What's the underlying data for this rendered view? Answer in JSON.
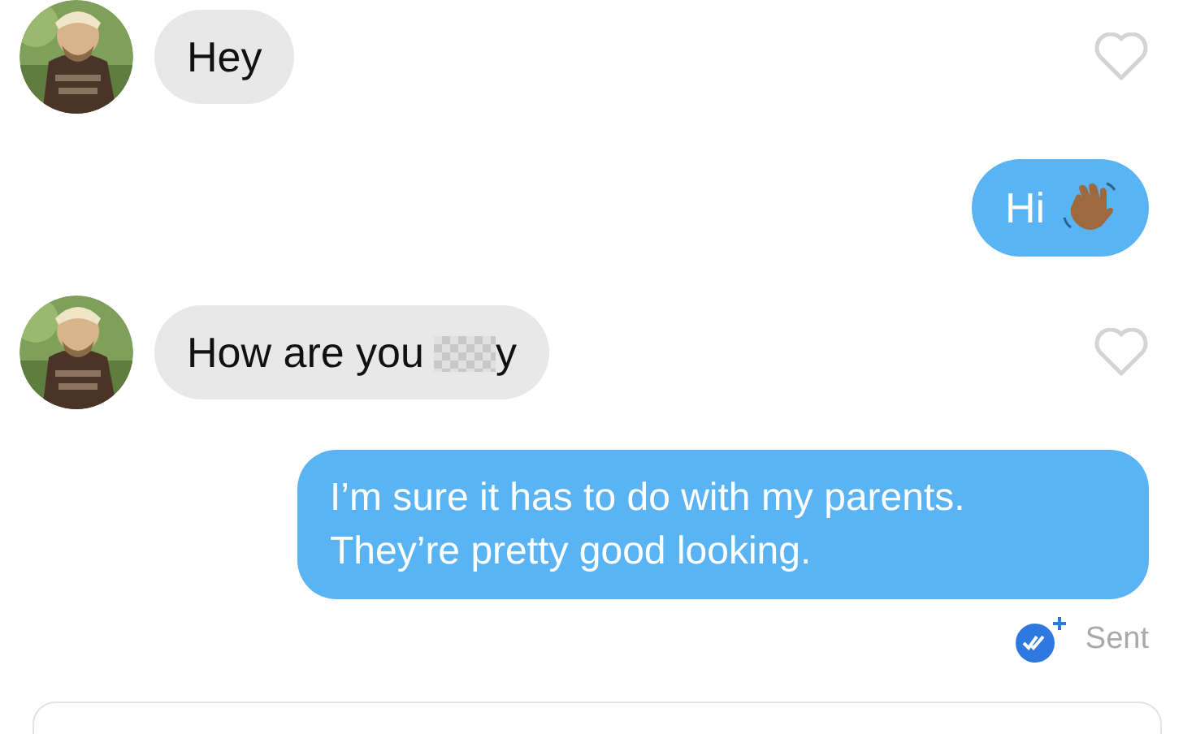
{
  "messages": [
    {
      "kind": "received",
      "text": "Hey",
      "liked": false
    },
    {
      "kind": "sent",
      "text": "Hi",
      "waving_hand": true
    },
    {
      "kind": "received",
      "text": "How are you",
      "redacted": true,
      "text_after": "y",
      "liked": false
    },
    {
      "kind": "sent",
      "text": "I’m sure it has to do with my parents. They’re pretty good looking."
    }
  ],
  "status": {
    "text": "Sent",
    "delivered": true
  }
}
